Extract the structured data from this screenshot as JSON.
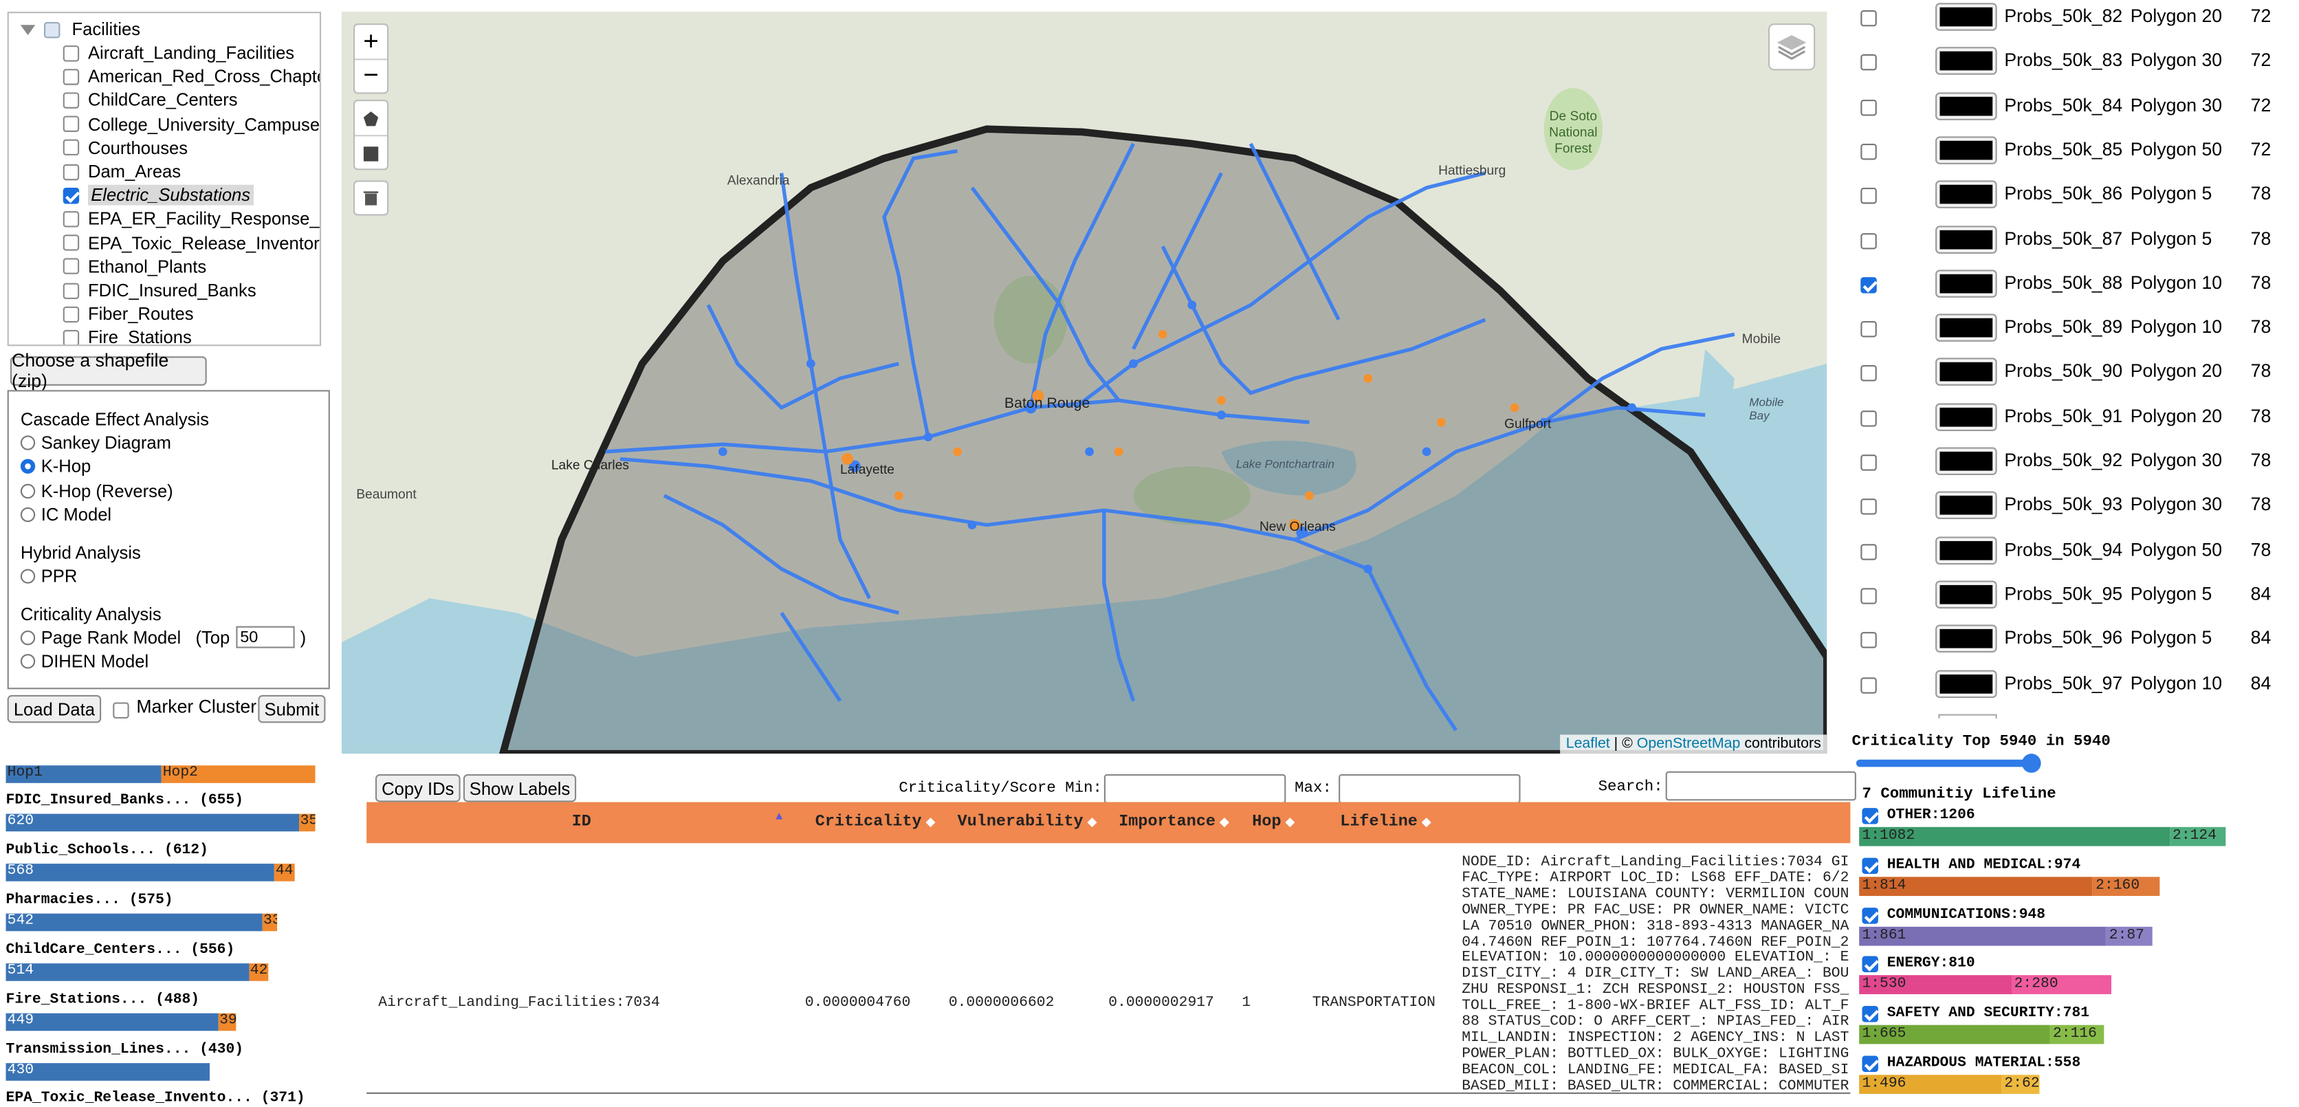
{
  "tree": {
    "root": "Facilities",
    "items": [
      {
        "label": "Aircraft_Landing_Facilities",
        "checked": false
      },
      {
        "label": "American_Red_Cross_Chapter_F",
        "checked": false
      },
      {
        "label": "ChildCare_Centers",
        "checked": false
      },
      {
        "label": "College_University_Campuses",
        "checked": false
      },
      {
        "label": "Courthouses",
        "checked": false
      },
      {
        "label": "Dam_Areas",
        "checked": false
      },
      {
        "label": "Electric_Substations",
        "checked": true
      },
      {
        "label": "EPA_ER_Facility_Response_Plan",
        "checked": false
      },
      {
        "label": "EPA_Toxic_Release_Inventory_F",
        "checked": false
      },
      {
        "label": "Ethanol_Plants",
        "checked": false
      },
      {
        "label": "FDIC_Insured_Banks",
        "checked": false
      },
      {
        "label": "Fiber_Routes",
        "checked": false
      },
      {
        "label": "Fire_Stations",
        "checked": false
      }
    ]
  },
  "shapefile_button": "Choose a shapefile (zip)",
  "analysis": {
    "cascade_title": "Cascade Effect Analysis",
    "cascade_options": [
      "Sankey Diagram",
      "K-Hop",
      "K-Hop (Reverse)",
      "IC Model"
    ],
    "cascade_selected": "K-Hop",
    "hybrid_title": "Hybrid Analysis",
    "hybrid_options": [
      "PPR"
    ],
    "criticality_title": "Criticality Analysis",
    "criticality_options": [
      "Page Rank Model",
      "DIHEN Model"
    ],
    "top_label": "(Top",
    "top_value": "50",
    "top_close": ")"
  },
  "controls": {
    "load": "Load Data",
    "marker_cluster": "Marker Cluster",
    "submit": "Submit"
  },
  "hop_legend": {
    "hop1": "Hop1",
    "hop2": "Hop2"
  },
  "hop_bars": [
    {
      "label": "FDIC_Insured_Banks... (655)",
      "hop1": 620,
      "hop2": 35
    },
    {
      "label": "Public_Schools... (612)",
      "hop1": 568,
      "hop2": 44
    },
    {
      "label": "Pharmacies... (575)",
      "hop1": 542,
      "hop2": 33
    },
    {
      "label": "ChildCare_Centers... (556)",
      "hop1": 514,
      "hop2": 42
    },
    {
      "label": "Fire_Stations... (488)",
      "hop1": 449,
      "hop2": 39
    },
    {
      "label": "Transmission_Lines... (430)",
      "hop1": 430,
      "hop2": 0
    },
    {
      "label": "EPA_Toxic_Release_Invento... (371)",
      "hop1": 0,
      "hop2": 0
    }
  ],
  "map": {
    "zoom_in": "+",
    "zoom_out": "−",
    "places": [
      "Alexandria",
      "Hattiesburg",
      "De Soto National Forest",
      "Lake Charles",
      "Beaumont",
      "Baton Rouge",
      "Lafayette",
      "Lake Pontchartrain",
      "New Orleans",
      "Mobile",
      "Mobile Bay",
      "Gulfport"
    ],
    "attribution_leaflet": "Leaflet",
    "attribution_sep": " | © ",
    "attribution_osm": "OpenStreetMap",
    "attribution_tail": " contributors"
  },
  "table": {
    "copy_ids": "Copy IDs",
    "show_labels": "Show Labels",
    "min_label": "Criticality/Score Min:",
    "max_label": "Max:",
    "search_label": "Search:",
    "headers": [
      "ID",
      "Criticality",
      "Vulnerability",
      "Importance",
      "Hop",
      "Lifeline"
    ],
    "row": {
      "id": "Aircraft_Landing_Facilities:7034",
      "criticality": "0.0000004760",
      "vulnerability": "0.0000006602",
      "importance": "0.0000002917",
      "hop": "1",
      "lifeline": "TRANSPORTATION",
      "details": [
        "NODE_ID: Aircraft_Landing_Facilities:7034 GI",
        "FAC_TYPE: AIRPORT LOC_ID: LS68 EFF_DATE: 6/2",
        "STATE_NAME: LOUISIANA COUNTY: VERMILION COUN",
        "OWNER_TYPE: PR FAC_USE: PR OWNER_NAME: VICTC",
        "LA 70510 OWNER_PHON: 318-893-4313 MANAGER_NA",
        "04.7460N REF_POIN_1: 107764.7460N REF_POIN_2",
        "ELEVATION: 10.0000000000000000 ELEVATION_: E",
        "DIST_CITY_: 4 DIR_CITY_T: SW LAND_AREA_: BOU",
        "ZHU RESPONSI_1: ZCH RESPONSI_2: HOUSTON FSS_",
        "TOLL_FREE_: 1-800-WX-BRIEF ALT_FSS_ID: ALT_F",
        "88 STATUS_COD: O ARFF_CERT_: NPIAS_FED_: AIR",
        "MIL_LANDIN: INSPECTION: 2 AGENCY_INS: N LAST",
        "POWER_PLAN: BOTTLED_OX: BULK_OXYGE: LIGHTING",
        "BEACON_COL: LANDING_FE: MEDICAL_FA: BASED_SI",
        "BASED_MILI: BASED_ULTR: COMMERCIAL: COMMUTER"
      ]
    }
  },
  "layers": [
    {
      "name": "Probs_50k_82",
      "type": "Polygon 20",
      "value": "72",
      "checked": false
    },
    {
      "name": "Probs_50k_83",
      "type": "Polygon 30",
      "value": "72",
      "checked": false
    },
    {
      "name": "Probs_50k_84",
      "type": "Polygon 30",
      "value": "72",
      "checked": false
    },
    {
      "name": "Probs_50k_85",
      "type": "Polygon 50",
      "value": "72",
      "checked": false
    },
    {
      "name": "Probs_50k_86",
      "type": "Polygon 5",
      "value": "78",
      "checked": false
    },
    {
      "name": "Probs_50k_87",
      "type": "Polygon 5",
      "value": "78",
      "checked": false
    },
    {
      "name": "Probs_50k_88",
      "type": "Polygon 10",
      "value": "78",
      "checked": true
    },
    {
      "name": "Probs_50k_89",
      "type": "Polygon 10",
      "value": "78",
      "checked": false
    },
    {
      "name": "Probs_50k_90",
      "type": "Polygon 20",
      "value": "78",
      "checked": false
    },
    {
      "name": "Probs_50k_91",
      "type": "Polygon 20",
      "value": "78",
      "checked": false
    },
    {
      "name": "Probs_50k_92",
      "type": "Polygon 30",
      "value": "78",
      "checked": false
    },
    {
      "name": "Probs_50k_93",
      "type": "Polygon 30",
      "value": "78",
      "checked": false
    },
    {
      "name": "Probs_50k_94",
      "type": "Polygon 50",
      "value": "78",
      "checked": false
    },
    {
      "name": "Probs_50k_95",
      "type": "Polygon 5",
      "value": "84",
      "checked": false
    },
    {
      "name": "Probs_50k_96",
      "type": "Polygon 5",
      "value": "84",
      "checked": false
    },
    {
      "name": "Probs_50k_97",
      "type": "Polygon 10",
      "value": "84",
      "checked": false
    }
  ],
  "criticality_slider": {
    "label": "Criticality Top 5940 in 5940",
    "fraction": 1.0
  },
  "lifelines": {
    "title": "7 Communitiy Lifeline",
    "items": [
      {
        "label": "OTHER:1206",
        "h1": "1:1082",
        "h2": "2:124",
        "c1": "#3a9a6a",
        "c2": "#4fae7e",
        "checked": true
      },
      {
        "label": "HEALTH AND MEDICAL:974",
        "h1": "1:814",
        "h2": "2:160",
        "c1": "#d0652a",
        "c2": "#e07a3a",
        "checked": true
      },
      {
        "label": "COMMUNICATIONS:948",
        "h1": "1:861",
        "h2": "2:87",
        "c1": "#7a6fb4",
        "c2": "#8b80c4",
        "checked": true
      },
      {
        "label": "ENERGY:810",
        "h1": "1:530",
        "h2": "2:280",
        "c1": "#e2478d",
        "c2": "#ef5b9e",
        "checked": true
      },
      {
        "label": "SAFETY AND SECURITY:781",
        "h1": "1:665",
        "h2": "2:116",
        "c1": "#72a83a",
        "c2": "#88bc48",
        "checked": true
      },
      {
        "label": "HAZARDOUS MATERIAL:558",
        "h1": "1:496",
        "h2": "2:62",
        "c1": "#e6a92e",
        "c2": "#efb93e",
        "checked": true
      }
    ]
  }
}
